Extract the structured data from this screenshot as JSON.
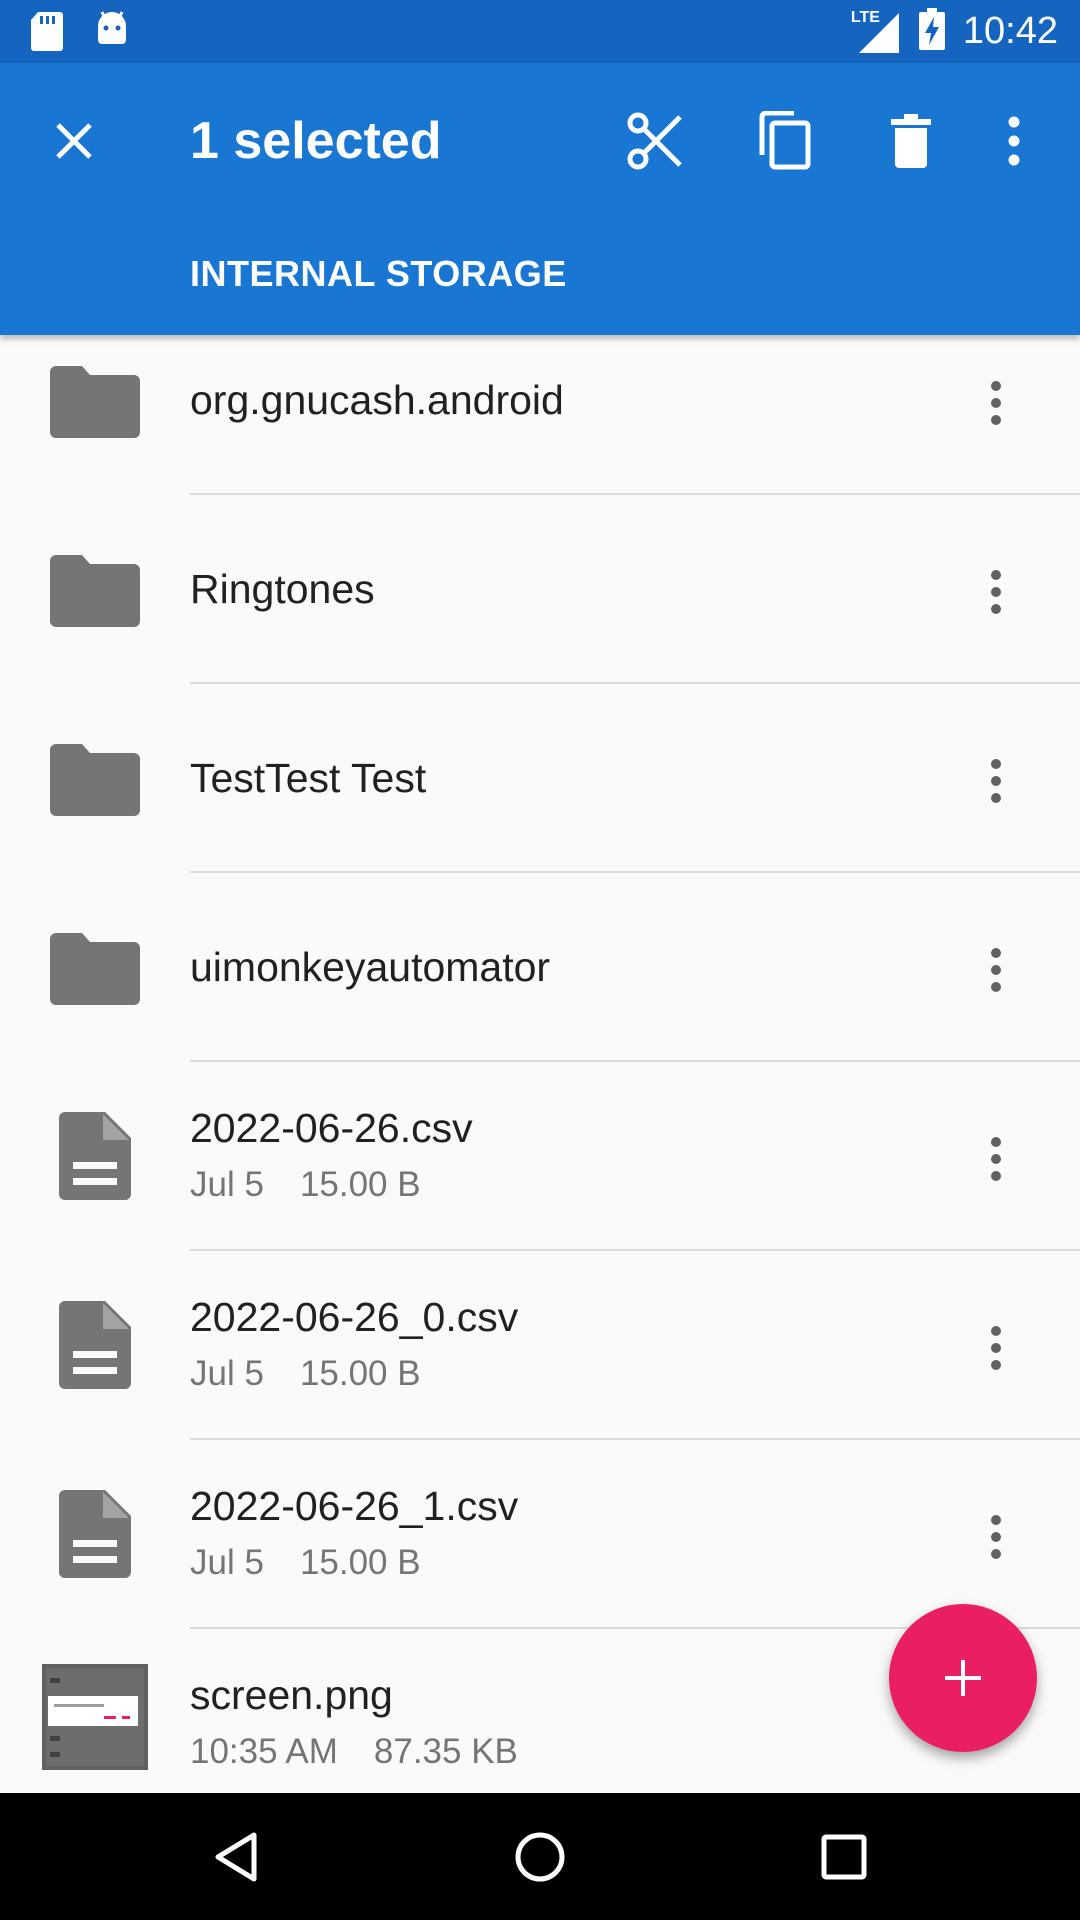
{
  "status_bar": {
    "time": "10:42",
    "network": "LTE",
    "icons": [
      "sd-card-icon",
      "android-icon",
      "signal-icon",
      "battery-charging-icon"
    ]
  },
  "app_bar": {
    "title": "1 selected",
    "tab_label": "INTERNAL STORAGE",
    "actions": [
      "close-icon",
      "cut-icon",
      "copy-icon",
      "delete-icon",
      "overflow-menu-icon"
    ],
    "background": "#1976d2"
  },
  "files": [
    {
      "name": "org.gnucash.android",
      "type": "folder"
    },
    {
      "name": "Ringtones",
      "type": "folder"
    },
    {
      "name": "TestTest Test",
      "type": "folder"
    },
    {
      "name": "uimonkeyautomator",
      "type": "folder"
    },
    {
      "name": "2022-06-26.csv",
      "type": "file",
      "date": "Jul 5",
      "size": "15.00 B"
    },
    {
      "name": "2022-06-26_0.csv",
      "type": "file",
      "date": "Jul 5",
      "size": "15.00 B"
    },
    {
      "name": "2022-06-26_1.csv",
      "type": "file",
      "date": "Jul 5",
      "size": "15.00 B"
    },
    {
      "name": "screen.png",
      "type": "image",
      "date": "10:35 AM",
      "size": "87.35 KB"
    }
  ],
  "fab": {
    "icon": "plus-icon",
    "color": "#e91e63"
  },
  "nav_bar": {
    "buttons": [
      "back-icon",
      "home-icon",
      "recents-icon"
    ]
  }
}
